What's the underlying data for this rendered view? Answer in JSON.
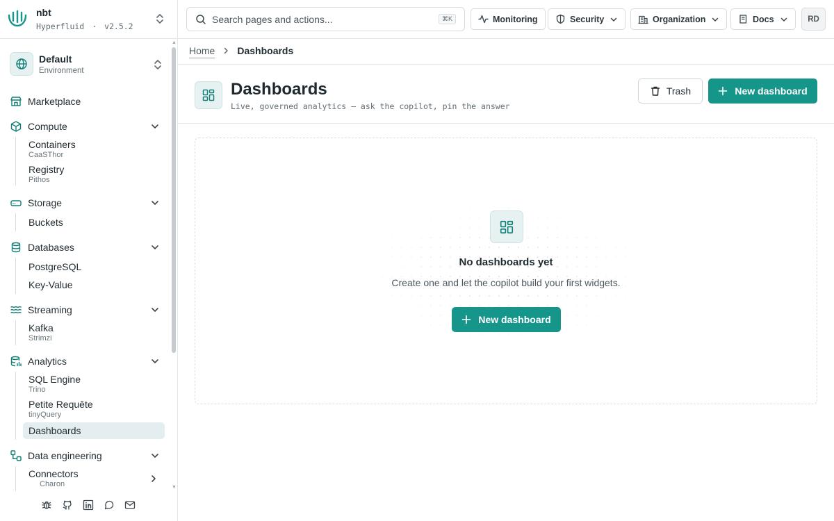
{
  "brand": {
    "name": "nbt",
    "product": "Hyperfluid",
    "separator": "·",
    "version": "v2.5.2"
  },
  "environment": {
    "name": "Default",
    "label": "Environment"
  },
  "sidebar": {
    "marketplace": "Marketplace",
    "compute": {
      "label": "Compute",
      "items": [
        {
          "label": "Containers",
          "hint": "CaaSThor"
        },
        {
          "label": "Registry",
          "hint": "Pithos"
        }
      ]
    },
    "storage": {
      "label": "Storage",
      "items": [
        {
          "label": "Buckets"
        }
      ]
    },
    "databases": {
      "label": "Databases",
      "items": [
        {
          "label": "PostgreSQL"
        },
        {
          "label": "Key-Value"
        }
      ]
    },
    "streaming": {
      "label": "Streaming",
      "items": [
        {
          "label": "Kafka",
          "hint": "Strimzi"
        }
      ]
    },
    "analytics": {
      "label": "Analytics",
      "items": [
        {
          "label": "SQL Engine",
          "hint": "Trino"
        },
        {
          "label": "Petite Requête",
          "hint": "tinyQuery"
        },
        {
          "label": "Dashboards"
        }
      ]
    },
    "data_engineering": {
      "label": "Data engineering",
      "items": [
        {
          "label": "Connectors",
          "hint": "Charon"
        }
      ]
    }
  },
  "topbar": {
    "search": {
      "placeholder": "Search pages and actions...",
      "shortcut": "⌘K"
    },
    "monitoring": "Monitoring",
    "security": "Security",
    "organization": "Organization",
    "docs": "Docs",
    "avatar": "RD"
  },
  "breadcrumb": {
    "home": "Home",
    "current": "Dashboards"
  },
  "page": {
    "title": "Dashboards",
    "subtitle": "Live, governed analytics — ask the copilot, pin the answer",
    "trash_label": "Trash",
    "new_label": "New dashboard"
  },
  "empty_state": {
    "title": "No dashboards yet",
    "subtitle": "Create one and let the copilot build your first widgets.",
    "button": "New dashboard"
  },
  "colors": {
    "accent": "#16968b",
    "accent_dark": "#127e77",
    "accent_bg": "#e6f2f1",
    "active_item_bg": "#e4eef0"
  }
}
